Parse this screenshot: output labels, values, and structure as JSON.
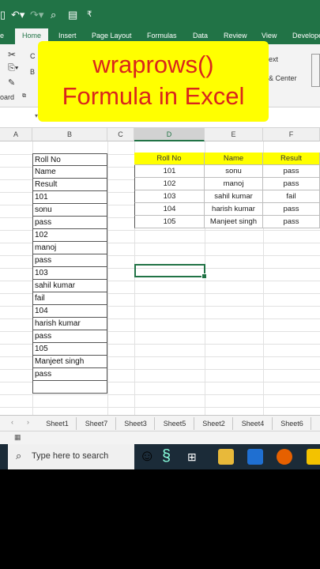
{
  "ribbon": {
    "tabs": [
      "e",
      "Home",
      "Insert",
      "Page Layout",
      "Formulas",
      "Data",
      "Review",
      "View",
      "Develope"
    ],
    "active_tab": "Home",
    "clipboard_label": "oard",
    "text_label": "ext",
    "center_label": "& Center"
  },
  "banner": {
    "line1": "wraprows()",
    "line2": "Formula in Excel"
  },
  "columns": [
    "A",
    "B",
    "C",
    "D",
    "E",
    "F"
  ],
  "source_list": [
    "Roll No",
    "Name",
    "Result",
    "101",
    "sonu",
    "pass",
    "102",
    "manoj",
    "pass",
    "103",
    "sahil kumar",
    "fail",
    "104",
    "harish kumar",
    "pass",
    "105",
    "Manjeet singh",
    "pass",
    ""
  ],
  "result_table": {
    "headers": [
      "Roll No",
      "Name",
      "Result"
    ],
    "rows": [
      [
        "101",
        "sonu",
        "pass"
      ],
      [
        "102",
        "manoj",
        "pass"
      ],
      [
        "103",
        "sahil kumar",
        "fail"
      ],
      [
        "104",
        "harish kumar",
        "pass"
      ],
      [
        "105",
        "Manjeet singh",
        "pass"
      ]
    ]
  },
  "sheets": [
    "Sheet1",
    "Sheet7",
    "Sheet3",
    "Sheet5",
    "Sheet2",
    "Sheet4",
    "Sheet6"
  ],
  "taskbar": {
    "search_placeholder": "Type here to search"
  },
  "colors": {
    "excel_green": "#217346",
    "banner_yellow": "#ffff00",
    "banner_text": "#d9261c"
  }
}
